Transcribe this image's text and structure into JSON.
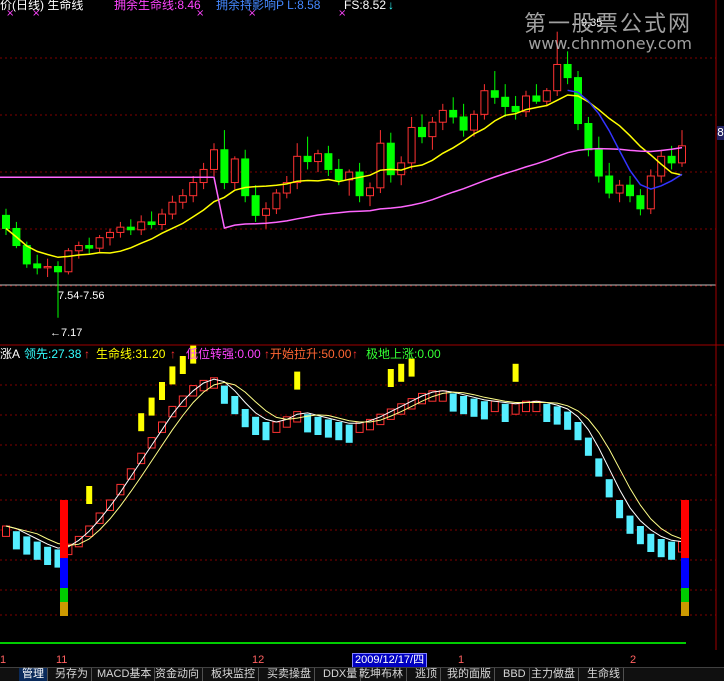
{
  "header": {
    "title": "价(日线) 生命线",
    "items": [
      {
        "label": "拥余生命线:8.46",
        "color": "#ff44ff"
      },
      {
        "label": "拥余持影响P L:8.58",
        "color": "#4488ff"
      },
      {
        "label": "FS:8.52",
        "color": "#ffffff"
      }
    ],
    "down_arrow": "↓",
    "marks": [
      "×",
      "×",
      "×",
      "×",
      "×"
    ]
  },
  "watermark": {
    "line1": "第一股票公式网",
    "line2": "www.chnmoney.com"
  },
  "indicator_header": {
    "name": "涨A",
    "items": [
      {
        "label": "领先:27.38",
        "color": "#33ffff"
      },
      {
        "label": "生命线:31.20",
        "color": "#ffff00"
      },
      {
        "label": "低位转强:0.00",
        "color": "#ff44ff"
      },
      {
        "label": "开始拉升:50.00",
        "color": "#ff6633"
      },
      {
        "label": "极地上涨:0.00",
        "color": "#33ff33"
      }
    ],
    "arrow": "↑"
  },
  "annotations": {
    "high": "9.35",
    "low": "7.17",
    "range": "7.54-7.56",
    "right_tag": "8"
  },
  "datebar": {
    "labels": [
      "1",
      "11",
      "12",
      "1",
      "2"
    ],
    "current": "2009/12/17/四"
  },
  "tabs": [
    "管理",
    "另存为",
    "MACD基本",
    "资金动向",
    "板块监控",
    "买卖操盘",
    "DDX量",
    "乾坤布林",
    "逃顶",
    "我的面版",
    "BBD",
    "主力做盘",
    "生命线"
  ],
  "active_tab": 0,
  "colors": {
    "up": "#ff3232",
    "down": "#00ff00",
    "ma_short": "#ffff00",
    "ma_long": "#ff66ff",
    "ma_blue": "#3333ff",
    "grid": "#800000",
    "ind_up": "#ff3232",
    "ind_down": "#55eeff",
    "signal": "#ffff00",
    "bottom_line": "#00cc00"
  },
  "chart_data": [
    {
      "type": "candlestick",
      "title": "价(日线) 生命线",
      "ohlc": [
        [
          7.95,
          8.0,
          7.8,
          7.85
        ],
        [
          7.85,
          7.9,
          7.7,
          7.72
        ],
        [
          7.72,
          7.75,
          7.55,
          7.58
        ],
        [
          7.58,
          7.65,
          7.5,
          7.55
        ],
        [
          7.55,
          7.62,
          7.48,
          7.56
        ],
        [
          7.56,
          7.6,
          7.17,
          7.52
        ],
        [
          7.52,
          7.7,
          7.5,
          7.68
        ],
        [
          7.68,
          7.75,
          7.62,
          7.72
        ],
        [
          7.72,
          7.78,
          7.65,
          7.7
        ],
        [
          7.7,
          7.8,
          7.66,
          7.78
        ],
        [
          7.78,
          7.85,
          7.72,
          7.82
        ],
        [
          7.82,
          7.9,
          7.78,
          7.86
        ],
        [
          7.86,
          7.92,
          7.8,
          7.84
        ],
        [
          7.84,
          7.95,
          7.8,
          7.9
        ],
        [
          7.9,
          7.98,
          7.85,
          7.88
        ],
        [
          7.88,
          8.0,
          7.84,
          7.96
        ],
        [
          7.96,
          8.1,
          7.92,
          8.05
        ],
        [
          8.05,
          8.15,
          8.0,
          8.1
        ],
        [
          8.1,
          8.25,
          8.05,
          8.2
        ],
        [
          8.2,
          8.35,
          8.15,
          8.3
        ],
        [
          8.3,
          8.5,
          8.25,
          8.45
        ],
        [
          8.45,
          8.6,
          8.15,
          8.2
        ],
        [
          8.2,
          8.4,
          8.15,
          8.38
        ],
        [
          8.38,
          8.45,
          8.05,
          8.1
        ],
        [
          8.1,
          8.18,
          7.9,
          7.95
        ],
        [
          7.95,
          8.05,
          7.85,
          8.0
        ],
        [
          8.0,
          8.15,
          7.96,
          8.12
        ],
        [
          8.12,
          8.25,
          8.08,
          8.2
        ],
        [
          8.2,
          8.5,
          8.15,
          8.4
        ],
        [
          8.4,
          8.55,
          8.3,
          8.36
        ],
        [
          8.36,
          8.45,
          8.28,
          8.42
        ],
        [
          8.42,
          8.48,
          8.25,
          8.3
        ],
        [
          8.3,
          8.38,
          8.18,
          8.22
        ],
        [
          8.22,
          8.3,
          8.1,
          8.28
        ],
        [
          8.28,
          8.35,
          8.05,
          8.1
        ],
        [
          8.1,
          8.2,
          8.02,
          8.16
        ],
        [
          8.16,
          8.6,
          8.12,
          8.5
        ],
        [
          8.5,
          8.58,
          8.2,
          8.26
        ],
        [
          8.26,
          8.4,
          8.18,
          8.35
        ],
        [
          8.35,
          8.7,
          8.3,
          8.62
        ],
        [
          8.62,
          8.72,
          8.5,
          8.55
        ],
        [
          8.55,
          8.7,
          8.45,
          8.66
        ],
        [
          8.66,
          8.8,
          8.6,
          8.75
        ],
        [
          8.75,
          8.85,
          8.65,
          8.7
        ],
        [
          8.7,
          8.8,
          8.55,
          8.6
        ],
        [
          8.6,
          8.75,
          8.55,
          8.72
        ],
        [
          8.72,
          8.95,
          8.68,
          8.9
        ],
        [
          8.9,
          9.05,
          8.8,
          8.85
        ],
        [
          8.85,
          8.95,
          8.7,
          8.78
        ],
        [
          8.78,
          8.86,
          8.68,
          8.74
        ],
        [
          8.74,
          8.9,
          8.7,
          8.86
        ],
        [
          8.86,
          8.95,
          8.8,
          8.82
        ],
        [
          8.82,
          8.92,
          8.78,
          8.9
        ],
        [
          8.9,
          9.35,
          8.86,
          9.1
        ],
        [
          9.1,
          9.2,
          8.95,
          9.0
        ],
        [
          9.0,
          9.05,
          8.6,
          8.65
        ],
        [
          8.65,
          8.7,
          8.4,
          8.45
        ],
        [
          8.45,
          8.55,
          8.2,
          8.25
        ],
        [
          8.25,
          8.35,
          8.08,
          8.12
        ],
        [
          8.12,
          8.22,
          8.05,
          8.18
        ],
        [
          8.18,
          8.25,
          8.05,
          8.1
        ],
        [
          8.1,
          8.15,
          7.95,
          8.0
        ],
        [
          8.0,
          8.3,
          7.96,
          8.25
        ],
        [
          8.25,
          8.45,
          8.2,
          8.4
        ],
        [
          8.4,
          8.48,
          8.3,
          8.35
        ],
        [
          8.35,
          8.6,
          8.32,
          8.48
        ]
      ],
      "series": [
        {
          "name": "拥余生命线",
          "color": "#ff66ff"
        },
        {
          "name": "拥余持影响P L",
          "color": "#3333ff"
        }
      ]
    },
    {
      "type": "bar",
      "title": "涨A",
      "values": [
        40,
        38,
        36,
        34,
        32,
        31,
        33,
        36,
        40,
        45,
        50,
        56,
        62,
        68,
        74,
        80,
        86,
        90,
        94,
        96,
        97,
        94,
        90,
        85,
        82,
        80,
        80,
        82,
        84,
        83,
        82,
        81,
        80,
        79,
        80,
        81,
        83,
        85,
        87,
        89,
        91,
        92,
        92,
        91,
        90,
        89,
        88,
        88,
        87,
        87,
        88,
        88,
        87,
        86,
        84,
        80,
        74,
        66,
        58,
        50,
        44,
        40,
        37,
        35,
        34,
        34
      ],
      "series": [
        {
          "name": "领先",
          "values_last": 27.38,
          "color": "#33ffff"
        },
        {
          "name": "生命线",
          "values_last": 31.2,
          "color": "#ffff00"
        },
        {
          "name": "低位转强",
          "values_last": 0.0,
          "color": "#ff44ff"
        },
        {
          "name": "开始拉升",
          "values_last": 50.0,
          "color": "#ff6633"
        },
        {
          "name": "极地上涨",
          "values_last": 0.0,
          "color": "#33ff33"
        }
      ]
    }
  ]
}
